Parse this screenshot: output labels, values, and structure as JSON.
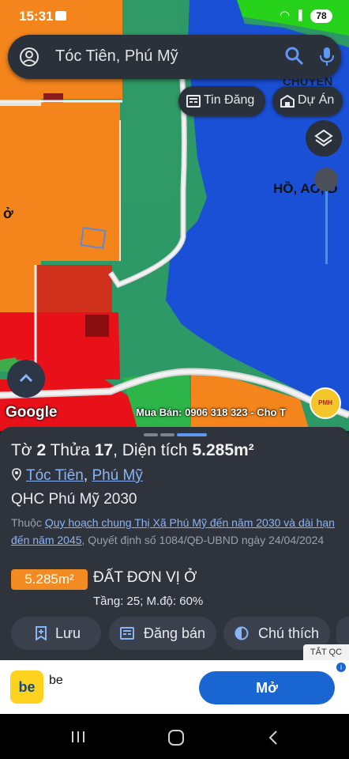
{
  "status_bar": {
    "time": "15:31",
    "battery": "78"
  },
  "search": {
    "value": "Tóc Tiên, Phú Mỹ"
  },
  "chips": {
    "listing_label": "Tin Đăng",
    "project_label": "Dự Án"
  },
  "map": {
    "labels": {
      "chuyen": "CHUYÊN",
      "ho": "HỒ, AO, Đ",
      "o": "ở"
    },
    "google_label": "Google",
    "watermark": "Mua Bán: 0906 318 323 - Cho T",
    "logo_text": "PMH"
  },
  "parcel": {
    "sheet_label": "Tờ",
    "sheet_no": "2",
    "plot_label": "Thửa",
    "plot_no": "17",
    "area_label": "Diện tích",
    "area": "5.285m²",
    "location": {
      "ward": "Tóc Tiên",
      "city": "Phú Mỹ"
    },
    "plan_name": "QHC Phú Mỹ 2030",
    "note_prefix": "Thuộc ",
    "note_link": "Quy hoạch chung Thị Xã Phú Mỹ đến năm 2030 và dài hạn đến năm 2045",
    "note_suffix": ", Quyết định số 1084/QĐ-UBND ngày 24/04/2024",
    "zone_area": "5.285m²",
    "zone_name": "ĐẤT ĐƠN VỊ Ở",
    "floors_density": "Tầng: 25; M.độ: 60%"
  },
  "actions": {
    "save": "Lưu",
    "post": "Đăng bán",
    "legend": "Chú thích"
  },
  "ad": {
    "close_label": "TẮT QC",
    "brand": "be",
    "app_name": "be",
    "open_label": "Mở",
    "info": "i"
  },
  "colors": {
    "accent_blue": "#8ab4f8",
    "zone_orange": "#f28c22",
    "open_button": "#1966d2"
  }
}
